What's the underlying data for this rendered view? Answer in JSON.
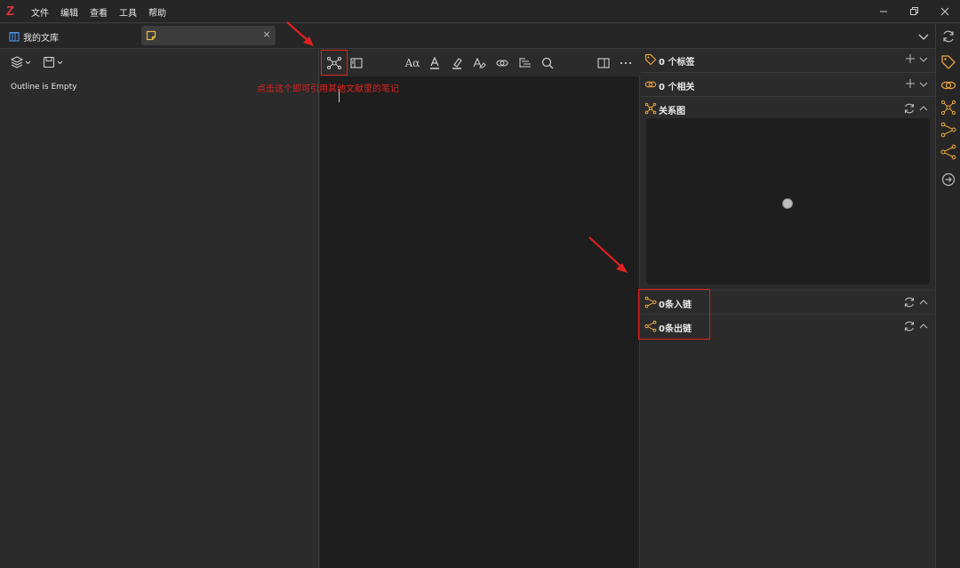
{
  "app": {
    "logo": "Z",
    "menu": [
      "文件",
      "编辑",
      "查看",
      "工具",
      "帮助"
    ]
  },
  "tabs": {
    "library_label": "我的文库",
    "note_tab_close": "×"
  },
  "outline": {
    "empty_text": "Outline is Empty"
  },
  "editor_toolbar": {
    "font_label": "Aα"
  },
  "right_panel": {
    "tags_title": "0 个标签",
    "related_title": "0 个相关",
    "graph_title": "关系图",
    "inbound_title": "0条入链",
    "outbound_title": "0条出链"
  },
  "annotation": {
    "text": "点击这个即可引用其他文献里的笔记"
  },
  "colors": {
    "accent_orange": "#e8a33a",
    "annotation_red": "#e02020",
    "logo_red": "#e0333a"
  }
}
